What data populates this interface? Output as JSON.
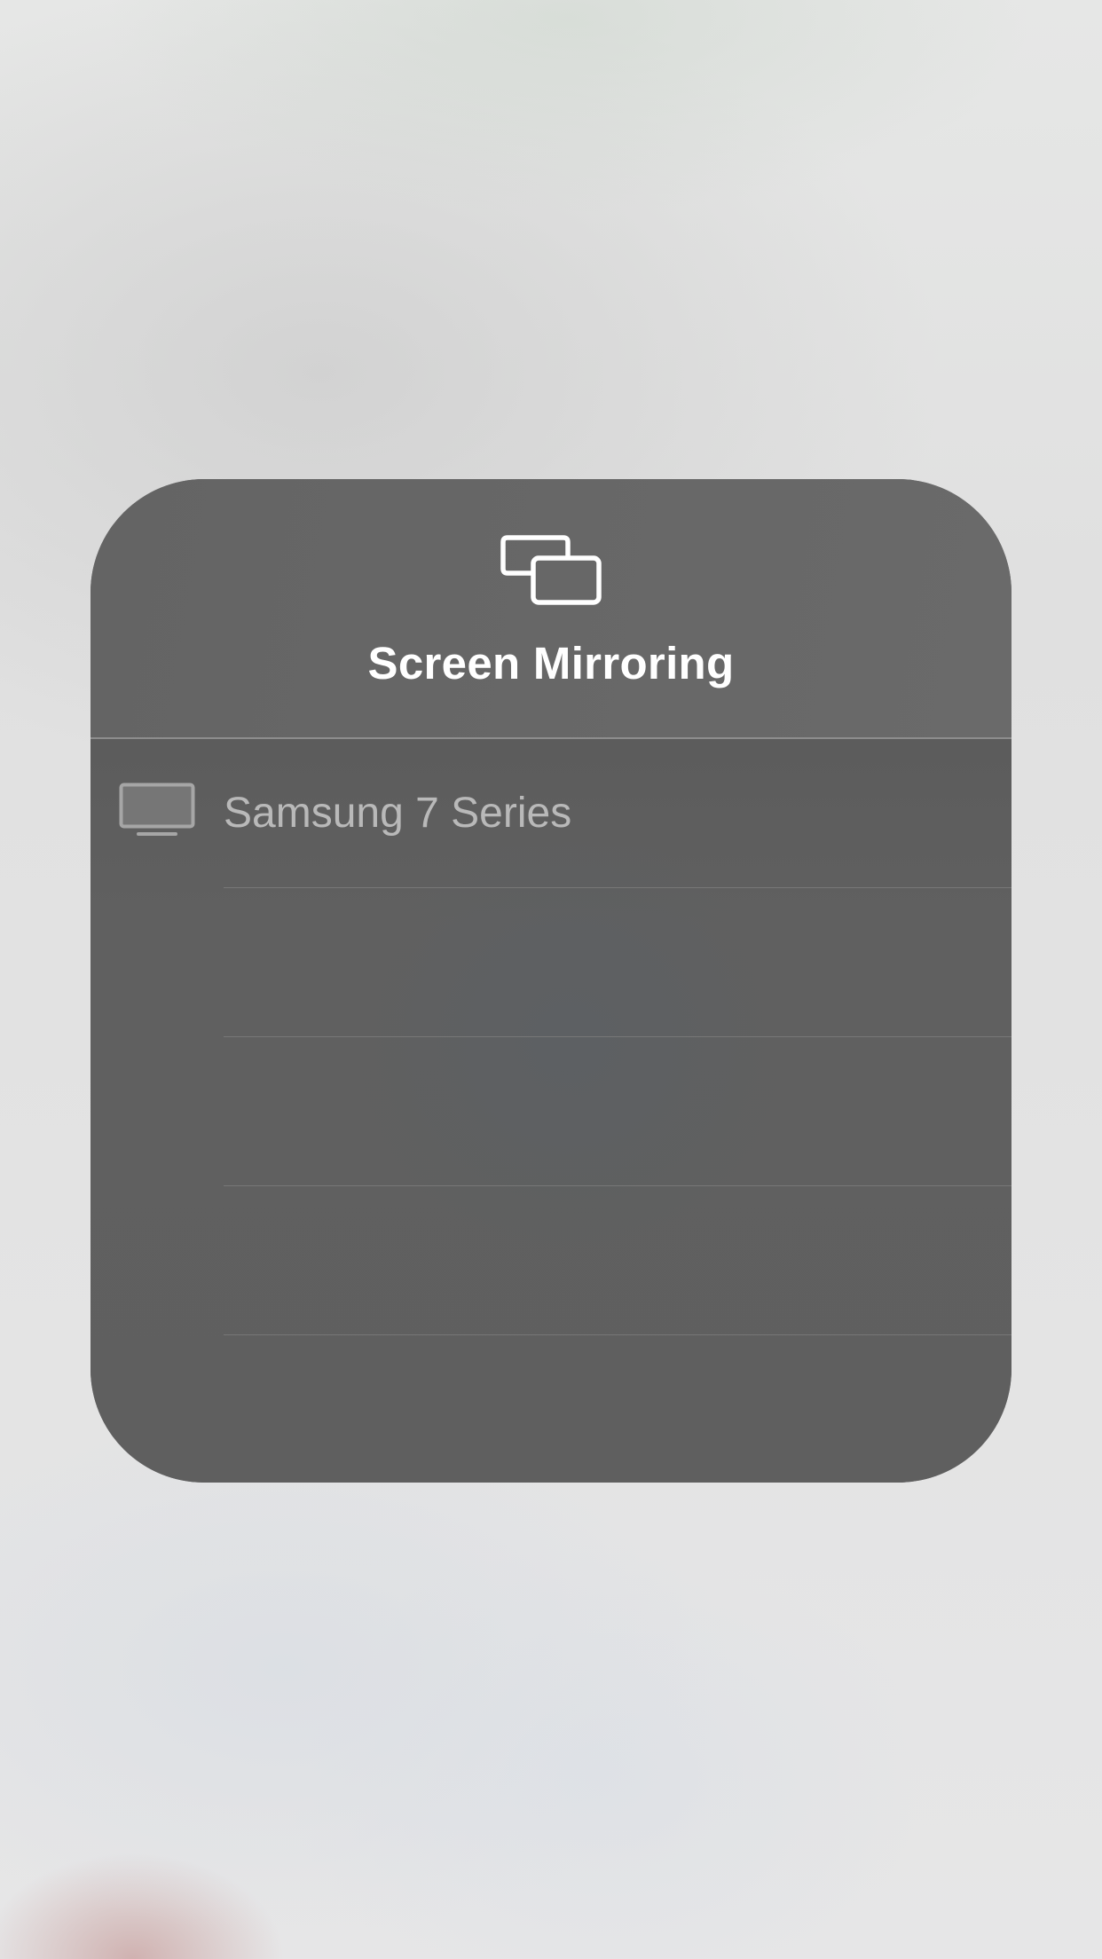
{
  "screen_mirroring": {
    "title": "Screen Mirroring",
    "icon": "screen-mirroring-icon",
    "devices": [
      {
        "name": "Samsung 7 Series",
        "icon": "tv-icon",
        "selected": false
      }
    ],
    "empty_rows": 4
  },
  "colors": {
    "panel_background": "#616161",
    "header_background": "#676767",
    "title_text": "#ffffff",
    "device_text": "#b9b9b9",
    "divider": "#777777"
  }
}
